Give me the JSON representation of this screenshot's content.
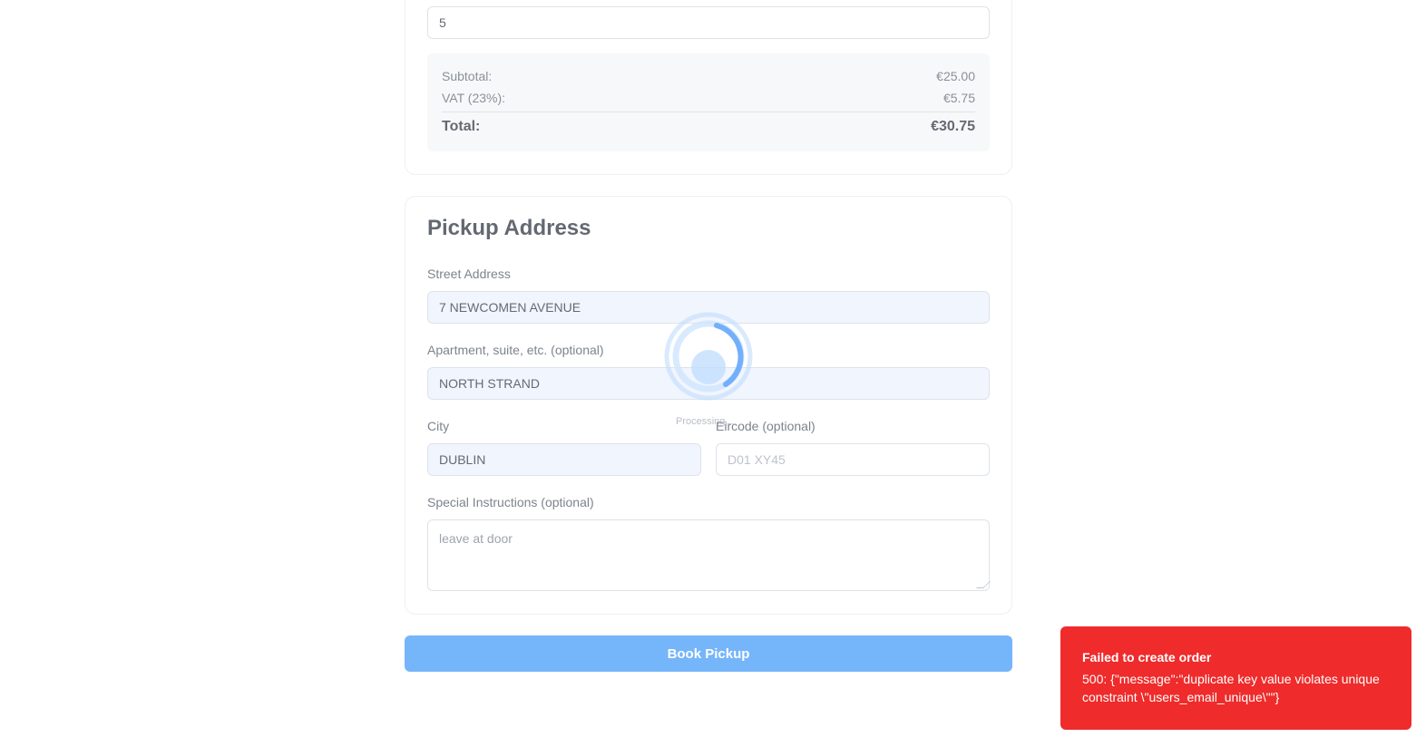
{
  "quantity": {
    "value": "5"
  },
  "summary": {
    "subtotal_label": "Subtotal:",
    "subtotal_value": "€25.00",
    "vat_label": "VAT (23%):",
    "vat_value": "€5.75",
    "total_label": "Total:",
    "total_value": "€30.75"
  },
  "address": {
    "title": "Pickup Address",
    "street_label": "Street Address",
    "street_value": "7 NEWCOMEN AVENUE",
    "apartment_label": "Apartment, suite, etc. (optional)",
    "apartment_value": "NORTH STRAND",
    "city_label": "City",
    "city_value": "DUBLIN",
    "eircode_label": "Eircode (optional)",
    "eircode_placeholder": "D01 XY45",
    "instructions_label": "Special Instructions (optional)",
    "instructions_value": "leave at door"
  },
  "actions": {
    "book_label": "Book Pickup"
  },
  "loading": {
    "text": "Processing..."
  },
  "toast": {
    "title": "Failed to create order",
    "message": "500: {\"message\":\"duplicate key value violates unique constraint \\\"users_email_unique\\\"\"}"
  },
  "colors": {
    "accent": "#2b8ef8",
    "error": "#ef2b2b",
    "autofill": "#e8f0fe"
  }
}
